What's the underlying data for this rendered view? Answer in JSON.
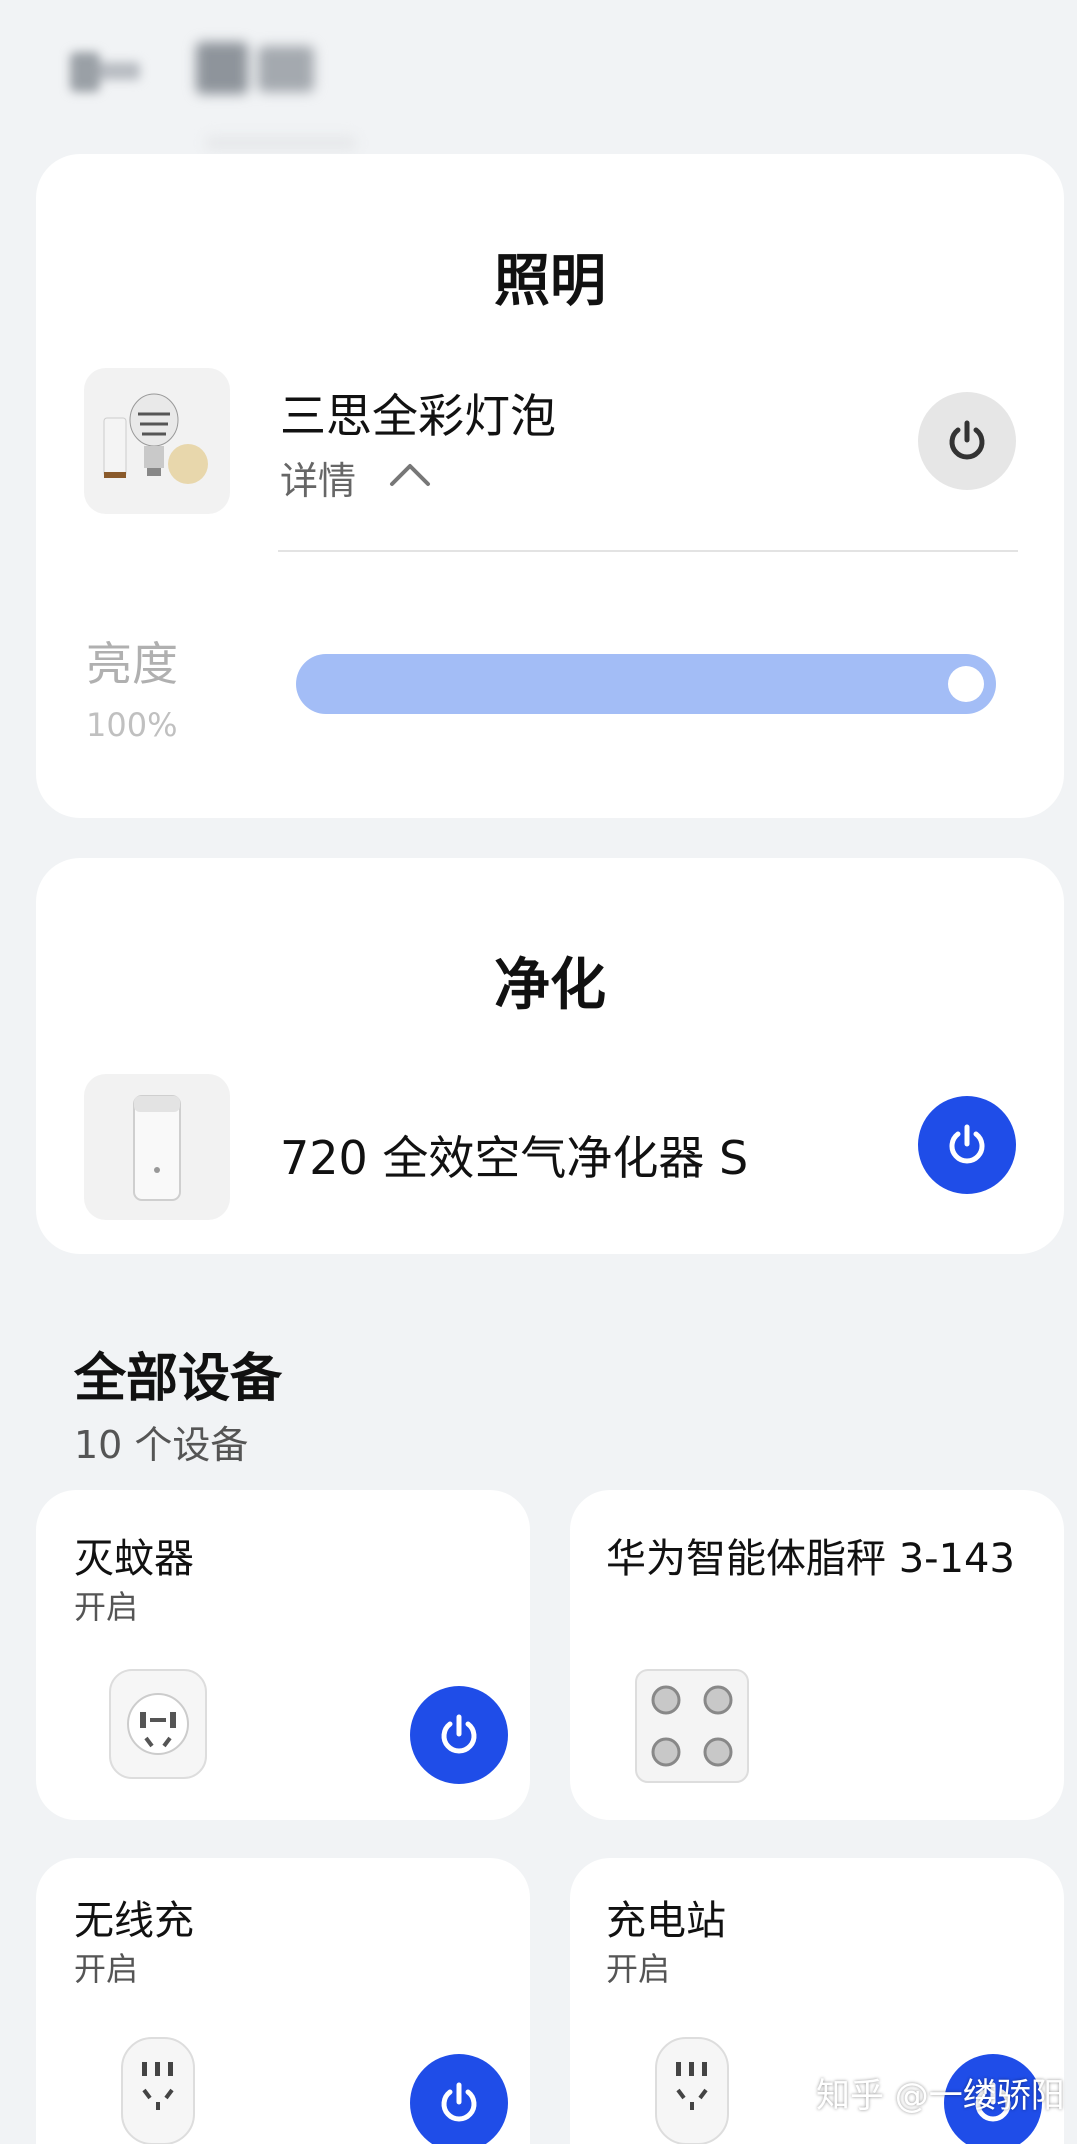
{
  "topbar": {
    "back_icon": "back-arrow-icon (blurred)"
  },
  "lighting": {
    "section_title": "照明",
    "device_name": "三思全彩灯泡",
    "details_label": "详情",
    "details_icon": "chevron-up-icon",
    "power_state": "off",
    "brightness_label": "亮度",
    "brightness_value": "100%",
    "brightness_level": 1.0
  },
  "purify": {
    "section_title": "净化",
    "device_name": "720 全效空气净化器 S",
    "power_state": "on"
  },
  "all_devices": {
    "title": "全部设备",
    "count": "10 个设备",
    "tiles": [
      {
        "name": "灭蚊器",
        "status": "开启",
        "power_state": "on"
      },
      {
        "name": "华为智能体脂秤 3-143",
        "status": "",
        "power_state": "none"
      },
      {
        "name": "无线充",
        "status": "开启",
        "power_state": "on"
      },
      {
        "name": "充电站",
        "status": "开启",
        "power_state": "on"
      }
    ]
  },
  "watermark": "知乎 @一缕骄阳",
  "colors": {
    "accent": "#1f4de8",
    "slider": "#a3bdf6",
    "background": "#f1f3f5"
  }
}
